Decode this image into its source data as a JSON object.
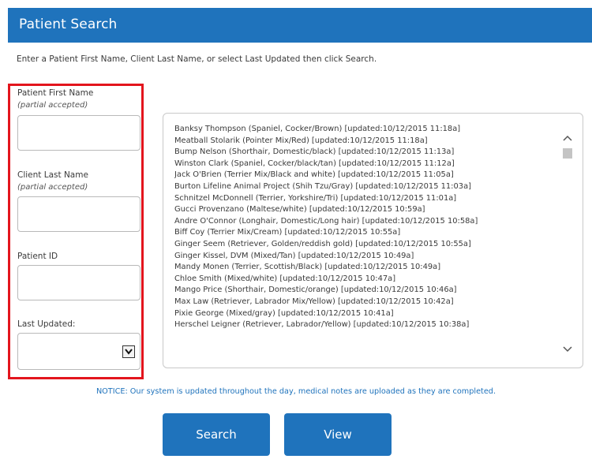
{
  "header": {
    "title": "Patient Search"
  },
  "instructions": "Enter a Patient First Name, Client Last Name, or select Last Updated then click Search.",
  "form": {
    "patient_first_name_label": "Patient First Name",
    "patient_first_name_hint": "(partial accepted)",
    "patient_first_name_value": "",
    "client_last_name_label": "Client Last Name",
    "client_last_name_hint": "(partial accepted)",
    "client_last_name_value": "",
    "patient_id_label": "Patient ID",
    "patient_id_value": "",
    "last_updated_label": "Last Updated:",
    "last_updated_value": ""
  },
  "results": [
    "Banksy Thompson (Spaniel, Cocker/Brown) [updated:10/12/2015 11:18a]",
    "Meatball Stolarik (Pointer Mix/Red) [updated:10/12/2015 11:18a]",
    "Bump Nelson (Shorthair, Domestic/black) [updated:10/12/2015 11:13a]",
    "Winston Clark (Spaniel, Cocker/black/tan) [updated:10/12/2015 11:12a]",
    "Jack O'Brien (Terrier Mix/Black and white) [updated:10/12/2015 11:05a]",
    "Burton Lifeline Animal Project (Shih Tzu/Gray) [updated:10/12/2015 11:03a]",
    "Schnitzel McDonnell (Terrier, Yorkshire/Tri) [updated:10/12/2015 11:01a]",
    "Gucci Provenzano (Maltese/white) [updated:10/12/2015 10:59a]",
    "Andre O'Connor (Longhair, Domestic/Long hair) [updated:10/12/2015 10:58a]",
    "Biff Coy (Terrier Mix/Cream) [updated:10/12/2015 10:55a]",
    "Ginger Seem (Retriever, Golden/reddish gold) [updated:10/12/2015 10:55a]",
    "Ginger Kissel, DVM (Mixed/Tan) [updated:10/12/2015 10:49a]",
    "Mandy Monen (Terrier, Scottish/Black) [updated:10/12/2015 10:49a]",
    "Chloe Smith (Mixed/white) [updated:10/12/2015 10:47a]",
    "Mango Price (Shorthair, Domestic/orange) [updated:10/12/2015 10:46a]",
    "Max Law (Retriever, Labrador Mix/Yellow) [updated:10/12/2015 10:42a]",
    "Pixie George (Mixed/gray) [updated:10/12/2015 10:41a]",
    "Herschel Leigner (Retriever, Labrador/Yellow) [updated:10/12/2015 10:38a]"
  ],
  "notice": "NOTICE: Our system is updated throughout the day, medical notes are uploaded as they are completed.",
  "buttons": {
    "search": "Search",
    "view": "View"
  },
  "icons": {
    "dropdown": "chevron-down-icon",
    "scroll_up": "chevron-up-icon",
    "scroll_down": "chevron-down-icon"
  },
  "colors": {
    "accent": "#1f73bc",
    "highlight_border": "#e3151d"
  }
}
